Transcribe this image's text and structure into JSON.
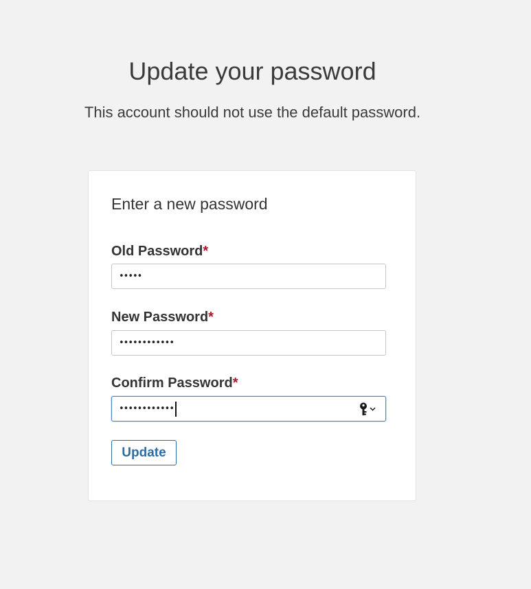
{
  "page": {
    "title": "Update your password",
    "subtitle": "This account should not use the default password."
  },
  "form": {
    "heading": "Enter a new password",
    "required_marker": "*",
    "fields": [
      {
        "label": "Old Password",
        "masked_value": "•••••",
        "focused": false
      },
      {
        "label": "New Password",
        "masked_value": "••••••••••••",
        "focused": false
      },
      {
        "label": "Confirm Password",
        "masked_value": "••••••••••••",
        "focused": true
      }
    ],
    "password_manager_icon": "key-icon",
    "submit_label": "Update"
  },
  "colors": {
    "background": "#f2f2f2",
    "card": "#ffffff",
    "required": "#b0132a",
    "accent": "#2e6da4",
    "focus_border": "#4f86c6"
  }
}
